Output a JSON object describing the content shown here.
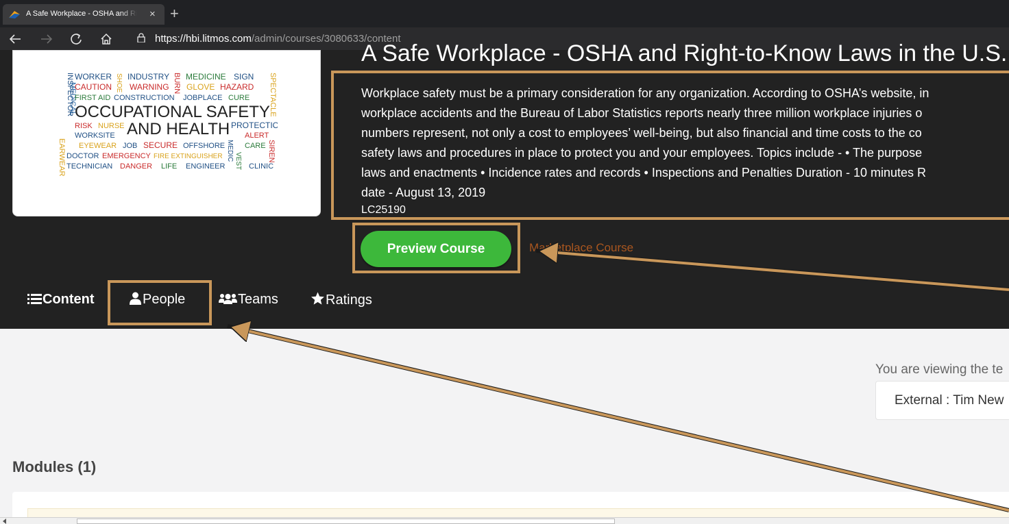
{
  "browser": {
    "tab_title": "A Safe Workplace - OSHA and Right-to-Know Laws in the U.S.",
    "close_glyph": "×",
    "new_tab_glyph": "+",
    "url_prefix": "https://",
    "url_host": "hbi.litmos.com",
    "url_path": "/admin/courses/3080633/content",
    "nav_icons": [
      "back-icon",
      "forward-icon",
      "refresh-icon",
      "home-icon",
      "lock-icon"
    ]
  },
  "course": {
    "title": "A Safe Workplace - OSHA and Right-to-Know Laws in the U.S.",
    "description_lines": [
      "Workplace safety must be a primary consideration for any organization. According to OSHA’s website, in",
      "workplace accidents and the Bureau of Labor Statistics reports nearly three million workplace injuries o",
      "numbers represent, not only a cost to employees’ well-being, but also financial and time costs to the co",
      "safety laws and procedures in place to protect you and your employees. Topics include - • The purpose",
      "laws and enactments • Incidence rates and records • Inspections and Penalties Duration - 10 minutes R",
      "date - August 13, 2019"
    ],
    "code": "LC25190",
    "preview_button": "Preview Course",
    "marketplace_link": "Marketplace Course"
  },
  "thumbnail": {
    "words": {
      "worker": "WORKER",
      "industry": "INDUSTRY",
      "medicine": "MEDICINE",
      "sign": "SIGN",
      "caution": "CAUTION",
      "warning": "WARNING",
      "glove": "GLOVE",
      "hazard": "HAZARD",
      "first_aid": "FIRST AID",
      "construction": "CONSTRUCTION",
      "jobplace": "JOBPLACE",
      "cure": "CURE",
      "occupational_safety": "OCCUPATIONAL SAFETY",
      "risk": "RISK",
      "nurse": "NURSE",
      "and_health": "AND HEALTH",
      "protection": "PROTECTION",
      "worksite": "WORKSITE",
      "alert": "ALERT",
      "eyewear": "EYEWEAR",
      "job": "JOB",
      "secure": "SECURE",
      "offshore": "OFFSHORE",
      "care": "CARE",
      "doctor": "DOCTOR",
      "emergency": "EMERGENCY",
      "fire_extinguisher": "FIRE EXTINGUISHER",
      "technician": "TECHNICIAN",
      "danger": "DANGER",
      "life": "LIFE",
      "engineer": "ENGINEER",
      "clinic": "CLINIC",
      "medical": "MEDICAL",
      "inspector": "INSPECTOR",
      "earwear": "EARWEAR",
      "shoe": "SHOE",
      "burn": "BURN",
      "spectacle": "SPECTACLE",
      "siren": "SIREN",
      "vest": "VEST",
      "medic": "MEDIC"
    }
  },
  "page_tabs": [
    {
      "label": "Content",
      "icon": "list-icon"
    },
    {
      "label": "People",
      "icon": "user-icon"
    },
    {
      "label": "Teams",
      "icon": "users-icon"
    },
    {
      "label": "Ratings",
      "icon": "star-icon"
    }
  ],
  "viewing": {
    "text": "You are viewing the te",
    "selected": "External : Tim New"
  },
  "modules": {
    "heading": "Modules (1)"
  },
  "colors": {
    "header_bg": "#222222",
    "annotation": "#c9975a",
    "preview_green": "#3db83b",
    "marketplace_orange": "#a9561f"
  }
}
